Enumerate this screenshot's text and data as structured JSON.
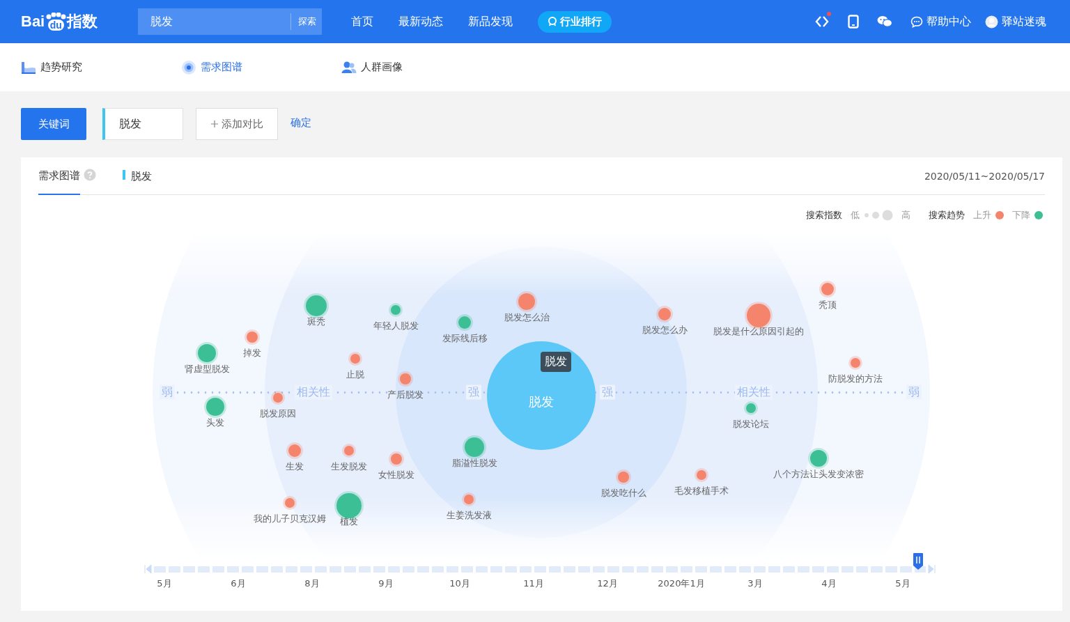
{
  "header": {
    "logo": {
      "text_1": "Bai",
      "paw_text": "du",
      "text_2": "指数"
    },
    "search": {
      "value": "脱发",
      "button": "探索"
    },
    "nav": [
      {
        "label": "首页",
        "kind": "plain"
      },
      {
        "label": "最新动态",
        "kind": "plain"
      },
      {
        "label": "新品发现",
        "kind": "plain"
      },
      {
        "label": "行业排行",
        "kind": "pill"
      }
    ],
    "help": "帮助中心",
    "user": "驿站迷魂",
    "notification": true
  },
  "subnav": [
    {
      "label": "趋势研究",
      "selected": false
    },
    {
      "label": "需求图谱",
      "selected": true
    },
    {
      "label": "人群画像",
      "selected": false
    }
  ],
  "toolbar": {
    "mode_button": "关键词",
    "keyword": "脱发",
    "add_compare": "添加对比",
    "confirm": "确定"
  },
  "card": {
    "tabs": [
      {
        "label": "需求图谱",
        "selected": true
      }
    ],
    "series_label": "脱发",
    "date_range": "2020/05/11~2020/05/17",
    "legend": {
      "index_title": "搜索指数",
      "low": "低",
      "high": "高",
      "trend_title": "搜索趋势",
      "trends": [
        {
          "label": "上升",
          "color": "#f5846c"
        },
        {
          "label": "下降",
          "color": "#3dbf95"
        }
      ]
    },
    "graph": {
      "center": "脱发",
      "tooltip": "脱发",
      "axis": [
        "弱",
        "相关性",
        "强",
        "强",
        "相关性",
        "弱"
      ],
      "nodes": [
        {
          "label": "斑秃",
          "color": "#3dbf95"
        },
        {
          "label": "年轻人脱发",
          "color": "#3dbf95"
        },
        {
          "label": "发际线后移",
          "color": "#3dbf95"
        },
        {
          "label": "脱发怎么治",
          "color": "#f5846c"
        },
        {
          "label": "脱发怎么办",
          "color": "#f5846c"
        },
        {
          "label": "脱发是什么原因引起的",
          "color": "#f5846c"
        },
        {
          "label": "秃顶",
          "color": "#f5846c"
        },
        {
          "label": "肾虚型脱发",
          "color": "#3dbf95"
        },
        {
          "label": "掉发",
          "color": "#f5846c"
        },
        {
          "label": "止脱",
          "color": "#f5846c"
        },
        {
          "label": "产后脱发",
          "color": "#f5846c"
        },
        {
          "label": "防脱发的方法",
          "color": "#f5846c"
        },
        {
          "label": "脱发原因",
          "color": "#f5846c"
        },
        {
          "label": "头发",
          "color": "#3dbf95"
        },
        {
          "label": "脱发论坛",
          "color": "#3dbf95"
        },
        {
          "label": "生发",
          "color": "#f5846c"
        },
        {
          "label": "生发脱发",
          "color": "#f5846c"
        },
        {
          "label": "女性脱发",
          "color": "#f5846c"
        },
        {
          "label": "脂溢性脱发",
          "color": "#3dbf95"
        },
        {
          "label": "八个方法让头发变浓密",
          "color": "#3dbf95"
        },
        {
          "label": "脱发吃什么",
          "color": "#f5846c"
        },
        {
          "label": "毛发移植手术",
          "color": "#f5846c"
        },
        {
          "label": "我的儿子贝克汉姆",
          "color": "#f5846c"
        },
        {
          "label": "植发",
          "color": "#3dbf95"
        },
        {
          "label": "生姜洗发液",
          "color": "#f5846c"
        }
      ]
    },
    "timeline": {
      "level": 0.99,
      "labels": [
        "5月",
        "6月",
        "8月",
        "9月",
        "10月",
        "11月",
        "12月",
        "2020年1月",
        "3月",
        "4月",
        "5月"
      ]
    }
  }
}
